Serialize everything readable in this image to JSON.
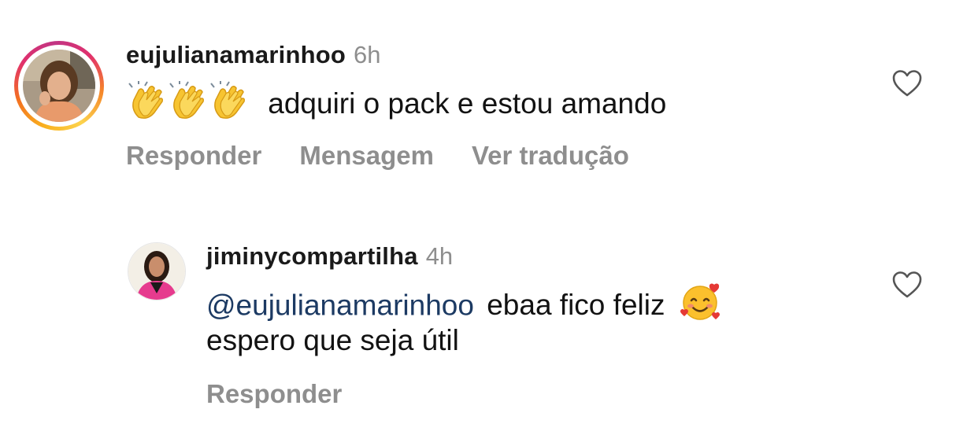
{
  "comments": [
    {
      "username": "eujulianamarinhoo",
      "time": "6h",
      "text": "adquiri o pack e estou amando",
      "emojis": [
        "clapping-hands",
        "clapping-hands",
        "clapping-hands"
      ],
      "actions": [
        "Responder",
        "Mensagem",
        "Ver tradução"
      ],
      "has_story_ring": true
    },
    {
      "username": "jiminycompartilha",
      "time": "4h",
      "mention": "@eujulianamarinhoo",
      "text_line1": "ebaa fico feliz",
      "text_line2": "espero que seja útil",
      "emojis": [
        "smiling-face-with-hearts"
      ],
      "actions": [
        "Responder"
      ],
      "has_story_ring": false
    }
  ],
  "colors": {
    "mention": "#1c3a63",
    "muted": "#8e8e8e",
    "text": "#121212"
  },
  "icons": [
    "heart-outline-icon"
  ]
}
